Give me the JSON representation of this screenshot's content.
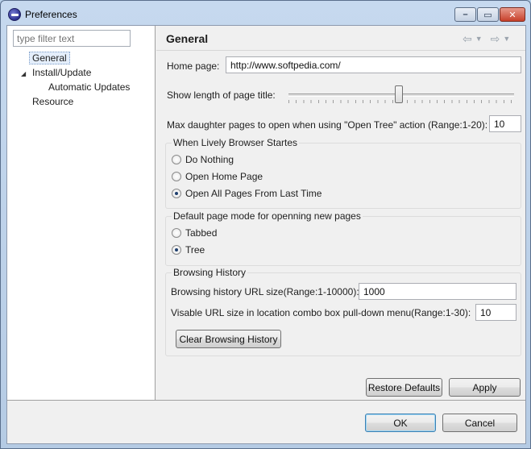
{
  "window": {
    "title": "Preferences",
    "controls": {
      "minimize": "–",
      "maximize": "▭",
      "close": "✕"
    }
  },
  "sidebar": {
    "filter_placeholder": "type filter text",
    "items": [
      {
        "label": "General",
        "selected": true
      },
      {
        "label": "Install/Update",
        "expanded": true
      },
      {
        "label": "Automatic Updates"
      },
      {
        "label": "Resource"
      }
    ]
  },
  "page": {
    "title": "General",
    "home_page_label": "Home page:",
    "home_page_value": "http://www.softpedia.com/",
    "show_length_label": "Show length of page title:",
    "max_daughter_label": "Max daughter pages to open when using \"Open Tree\" action (Range:1-20):",
    "max_daughter_value": "10",
    "startup_group": {
      "title": "When Lively Browser Startes",
      "options": [
        "Do Nothing",
        "Open Home Page",
        "Open All Pages From Last Time"
      ],
      "selected": "Open All Pages From Last Time"
    },
    "mode_group": {
      "title": "Default page mode for openning new pages",
      "options": [
        "Tabbed",
        "Tree"
      ],
      "selected": "Tree"
    },
    "history_group": {
      "title": "Browsing History",
      "url_size_label": "Browsing history URL size(Range:1-10000):",
      "url_size_value": "1000",
      "visable_label": "Visable URL size in location combo box pull-down menu(Range:1-30):",
      "visable_value": "10",
      "clear_button": "Clear Browsing History"
    },
    "restore_defaults": "Restore Defaults",
    "apply": "Apply"
  },
  "footer": {
    "ok": "OK",
    "cancel": "Cancel"
  },
  "colors": {
    "titlebar": "#c6d9ef",
    "client_bg": "#f0f0f0",
    "selection": "#e4eefb"
  }
}
